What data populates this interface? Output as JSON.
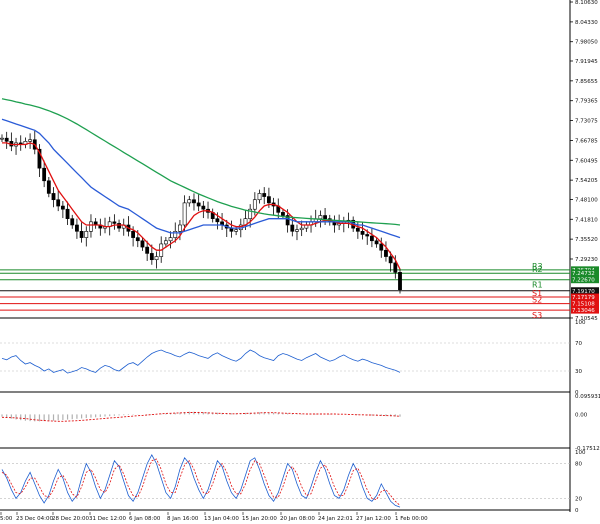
{
  "chart_data": {
    "type": "line",
    "instrument_style": "candlestick",
    "main_panel": {
      "y_ticks": [
        "8.10630",
        "8.04330",
        "7.98050",
        "7.91945",
        "7.85655",
        "7.79365",
        "7.73075",
        "7.66785",
        "7.60495",
        "7.54205",
        "7.48100",
        "7.41810",
        "7.35520",
        "7.29230",
        "7.10545"
      ],
      "ylim": [
        7.1054,
        8.1063
      ],
      "close_series": [
        7.675,
        7.665,
        7.65,
        7.66,
        7.655,
        7.665,
        7.67,
        7.64,
        7.58,
        7.54,
        7.5,
        7.48,
        7.46,
        7.45,
        7.42,
        7.4,
        7.38,
        7.36,
        7.38,
        7.41,
        7.4,
        7.39,
        7.395,
        7.41,
        7.405,
        7.39,
        7.4,
        7.38,
        7.36,
        7.35,
        7.33,
        7.31,
        7.29,
        7.3,
        7.34,
        7.35,
        7.36,
        7.38,
        7.4,
        7.47,
        7.48,
        7.47,
        7.46,
        7.45,
        7.44,
        7.42,
        7.41,
        7.4,
        7.39,
        7.38,
        7.385,
        7.4,
        7.42,
        7.45,
        7.48,
        7.5,
        7.49,
        7.47,
        7.46,
        7.44,
        7.43,
        7.4,
        7.38,
        7.385,
        7.39,
        7.4,
        7.41,
        7.42,
        7.43,
        7.42,
        7.41,
        7.4,
        7.405,
        7.41,
        7.415,
        7.39,
        7.38,
        7.37,
        7.365,
        7.35,
        7.34,
        7.32,
        7.3,
        7.28,
        7.25,
        7.195
      ],
      "series": [
        {
          "name": "",
          "color": "#e01010",
          "values": [
            7.66,
            7.66,
            7.655,
            7.655,
            7.655,
            7.655,
            7.66,
            7.655,
            7.63,
            7.6,
            7.57,
            7.54,
            7.51,
            7.49,
            7.47,
            7.45,
            7.43,
            7.41,
            7.4,
            7.4,
            7.4,
            7.4,
            7.395,
            7.395,
            7.4,
            7.4,
            7.4,
            7.39,
            7.385,
            7.375,
            7.36,
            7.345,
            7.33,
            7.32,
            7.32,
            7.33,
            7.34,
            7.35,
            7.365,
            7.39,
            7.41,
            7.43,
            7.44,
            7.445,
            7.445,
            7.44,
            7.43,
            7.42,
            7.41,
            7.4,
            7.395,
            7.395,
            7.4,
            7.41,
            7.425,
            7.445,
            7.46,
            7.465,
            7.465,
            7.46,
            7.45,
            7.44,
            7.425,
            7.41,
            7.4,
            7.4,
            7.4,
            7.405,
            7.41,
            7.415,
            7.415,
            7.41,
            7.405,
            7.405,
            7.405,
            7.4,
            7.395,
            7.39,
            7.38,
            7.37,
            7.36,
            7.345,
            7.33,
            7.31,
            7.29,
            7.26
          ]
        },
        {
          "name": "",
          "color": "#2a5bd7",
          "values": [
            7.735,
            7.73,
            7.725,
            7.72,
            7.715,
            7.71,
            7.705,
            7.7,
            7.69,
            7.675,
            7.66,
            7.64,
            7.625,
            7.61,
            7.595,
            7.58,
            7.565,
            7.55,
            7.535,
            7.52,
            7.51,
            7.5,
            7.49,
            7.48,
            7.47,
            7.46,
            7.455,
            7.45,
            7.44,
            7.43,
            7.42,
            7.41,
            7.4,
            7.39,
            7.385,
            7.38,
            7.375,
            7.375,
            7.375,
            7.38,
            7.385,
            7.39,
            7.395,
            7.4,
            7.4,
            7.4,
            7.4,
            7.4,
            7.395,
            7.39,
            7.39,
            7.39,
            7.395,
            7.4,
            7.405,
            7.41,
            7.415,
            7.42,
            7.42,
            7.42,
            7.42,
            7.42,
            7.415,
            7.41,
            7.41,
            7.41,
            7.41,
            7.41,
            7.41,
            7.41,
            7.41,
            7.41,
            7.41,
            7.41,
            7.41,
            7.405,
            7.4,
            7.4,
            7.395,
            7.39,
            7.385,
            7.38,
            7.375,
            7.37,
            7.365,
            7.36
          ]
        },
        {
          "name": "",
          "color": "#1fa050",
          "values": [
            7.8,
            7.797,
            7.794,
            7.79,
            7.787,
            7.783,
            7.78,
            7.776,
            7.772,
            7.767,
            7.762,
            7.756,
            7.75,
            7.743,
            7.736,
            7.728,
            7.72,
            7.711,
            7.702,
            7.693,
            7.684,
            7.675,
            7.666,
            7.657,
            7.648,
            7.639,
            7.63,
            7.621,
            7.612,
            7.603,
            7.594,
            7.585,
            7.576,
            7.567,
            7.558,
            7.549,
            7.54,
            7.533,
            7.526,
            7.519,
            7.512,
            7.505,
            7.498,
            7.492,
            7.486,
            7.48,
            7.474,
            7.469,
            7.464,
            7.459,
            7.455,
            7.451,
            7.447,
            7.444,
            7.441,
            7.438,
            7.435,
            7.433,
            7.431,
            7.429,
            7.427,
            7.425,
            7.424,
            7.423,
            7.422,
            7.421,
            7.42,
            7.419,
            7.418,
            7.417,
            7.416,
            7.415,
            7.414,
            7.413,
            7.412,
            7.411,
            7.41,
            7.409,
            7.408,
            7.407,
            7.406,
            7.405,
            7.404,
            7.403,
            7.402,
            7.4
          ]
        }
      ],
      "levels": [
        {
          "label": "R3",
          "value": "7.25794",
          "color": "#1a8a2a"
        },
        {
          "label": "R2",
          "value": "7.24732",
          "color": "#1a8a2a"
        },
        {
          "label": "R1",
          "value": "7.22670",
          "color": "#1a8a2a"
        },
        {
          "label": "",
          "value": "7.19170",
          "color": "#111111"
        },
        {
          "label": "S1",
          "value": "7.17179",
          "color": "#e01010"
        },
        {
          "label": "S2",
          "value": "7.15108",
          "color": "#e01010"
        },
        {
          "label": "S3",
          "value": "7.13046",
          "color": "#e01010"
        }
      ]
    },
    "rsi_panel": {
      "y_ticks": [
        "100",
        "70",
        "30",
        "0"
      ],
      "ylim": [
        0,
        100
      ],
      "values": [
        48,
        46,
        50,
        52,
        45,
        40,
        42,
        38,
        35,
        30,
        33,
        28,
        30,
        32,
        27,
        29,
        31,
        35,
        33,
        30,
        28,
        34,
        38,
        36,
        32,
        30,
        35,
        40,
        42,
        38,
        44,
        50,
        55,
        58,
        60,
        57,
        55,
        52,
        50,
        54,
        57,
        55,
        52,
        50,
        48,
        53,
        56,
        52,
        49,
        46,
        44,
        48,
        55,
        60,
        57,
        52,
        49,
        47,
        45,
        52,
        55,
        53,
        50,
        47,
        45,
        49,
        52,
        55,
        50,
        47,
        44,
        46,
        50,
        53,
        49,
        46,
        44,
        47,
        45,
        42,
        40,
        38,
        35,
        33,
        31,
        28
      ]
    },
    "macd_panel": {
      "y_ticks": [
        "0.095931",
        "0.00",
        "-0.175129"
      ],
      "ylim": [
        -0.175129,
        0.095931
      ],
      "signal": [
        -0.015,
        -0.016,
        -0.017,
        -0.018,
        -0.02,
        -0.022,
        -0.025,
        -0.028,
        -0.03,
        -0.032,
        -0.034,
        -0.035,
        -0.036,
        -0.036,
        -0.035,
        -0.034,
        -0.033,
        -0.031,
        -0.029,
        -0.027,
        -0.025,
        -0.023,
        -0.021,
        -0.019,
        -0.017,
        -0.015,
        -0.013,
        -0.011,
        -0.009,
        -0.007,
        -0.005,
        -0.003,
        -0.001,
        0.001,
        0.003,
        0.005,
        0.006,
        0.007,
        0.008,
        0.009,
        0.01,
        0.01,
        0.01,
        0.009,
        0.008,
        0.007,
        0.006,
        0.005,
        0.004,
        0.003,
        0.003,
        0.004,
        0.005,
        0.006,
        0.007,
        0.008,
        0.009,
        0.009,
        0.009,
        0.008,
        0.007,
        0.006,
        0.005,
        0.004,
        0.003,
        0.002,
        0.002,
        0.002,
        0.002,
        0.002,
        0.002,
        0.002,
        0.001,
        0.001,
        0.0,
        -0.001,
        -0.002,
        -0.002,
        -0.003,
        -0.003,
        -0.004,
        -0.005,
        -0.006,
        -0.007,
        -0.008,
        -0.01
      ],
      "histogram": [
        -0.012,
        -0.018,
        -0.022,
        -0.026,
        -0.03,
        -0.033,
        -0.035,
        -0.036,
        -0.036,
        -0.035,
        -0.034,
        -0.033,
        -0.031,
        -0.029,
        -0.027,
        -0.025,
        -0.023,
        -0.021,
        -0.019,
        -0.017,
        -0.015,
        -0.013,
        -0.011,
        -0.009,
        -0.007,
        -0.005,
        -0.004,
        -0.003,
        -0.002,
        -0.001,
        0.0,
        0.001,
        0.002,
        0.003,
        0.004,
        0.005,
        0.006,
        0.008,
        0.01,
        0.012,
        0.014,
        0.014,
        0.013,
        0.012,
        0.011,
        0.01,
        0.009,
        0.008,
        0.007,
        0.006,
        0.006,
        0.007,
        0.008,
        0.009,
        0.01,
        0.011,
        0.011,
        0.01,
        0.009,
        0.008,
        0.007,
        0.006,
        0.005,
        0.004,
        0.003,
        0.003,
        0.003,
        0.003,
        0.003,
        0.003,
        0.002,
        0.002,
        0.001,
        0.0,
        -0.001,
        -0.002,
        -0.003,
        -0.004,
        -0.005,
        -0.006,
        -0.007,
        -0.008,
        -0.009,
        -0.01,
        -0.011,
        -0.012
      ]
    },
    "stoch_panel": {
      "y_ticks": [
        "100",
        "80",
        "20",
        "0"
      ],
      "ylim": [
        0,
        100
      ],
      "k": [
        70,
        55,
        35,
        20,
        30,
        50,
        65,
        45,
        25,
        12,
        25,
        50,
        70,
        55,
        30,
        15,
        25,
        55,
        80,
        65,
        40,
        20,
        35,
        60,
        85,
        75,
        50,
        25,
        15,
        30,
        55,
        80,
        95,
        80,
        55,
        30,
        20,
        40,
        70,
        90,
        80,
        55,
        35,
        20,
        35,
        60,
        85,
        75,
        50,
        30,
        20,
        35,
        60,
        85,
        90,
        70,
        45,
        25,
        15,
        30,
        55,
        80,
        70,
        45,
        25,
        20,
        40,
        65,
        85,
        70,
        45,
        25,
        20,
        35,
        60,
        80,
        65,
        40,
        20,
        15,
        25,
        45,
        30,
        15,
        8,
        5
      ],
      "d": [
        65,
        60,
        45,
        30,
        28,
        40,
        55,
        55,
        40,
        25,
        22,
        35,
        55,
        60,
        45,
        28,
        22,
        40,
        65,
        70,
        55,
        35,
        30,
        45,
        70,
        78,
        62,
        40,
        25,
        22,
        40,
        65,
        85,
        88,
        70,
        45,
        30,
        30,
        55,
        78,
        85,
        70,
        48,
        30,
        28,
        45,
        70,
        80,
        65,
        42,
        28,
        28,
        45,
        70,
        85,
        80,
        60,
        38,
        22,
        22,
        40,
        65,
        75,
        62,
        40,
        25,
        28,
        50,
        72,
        78,
        62,
        40,
        25,
        25,
        45,
        68,
        72,
        55,
        35,
        20,
        18,
        32,
        35,
        25,
        15,
        8
      ]
    },
    "x_labels": [
      "5:00",
      "23 Dec 04:00",
      "28 Dec 20:00",
      "31 Dec 12:00",
      "6 Jan 08:00",
      "8 Jan 16:00",
      "13 Jan 04:00",
      "15 Jan 20:00",
      "20 Jan 08:00",
      "24 Jan 22:01",
      "27 Jan 12:00",
      "1 Feb 00:00"
    ]
  }
}
